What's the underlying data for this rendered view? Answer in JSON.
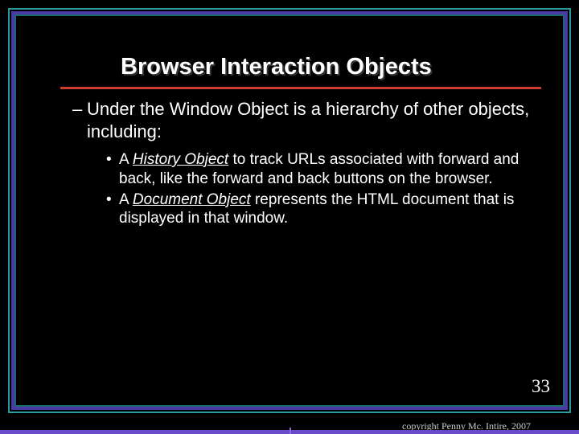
{
  "title": "Browser Interaction Objects",
  "intro": "Under the Window Object is a hierarchy of other objects, including:",
  "bullets": [
    {
      "prefix": "A ",
      "em": "History Object",
      "rest": " to track URLs associated with forward and back, like the forward and back buttons on the browser."
    },
    {
      "prefix": "A ",
      "em": "Document Object",
      "rest": " represents the HTML document that is displayed in that window."
    }
  ],
  "page_number": "33",
  "copyright": "copyright Penny Mc. Intire, 2007"
}
